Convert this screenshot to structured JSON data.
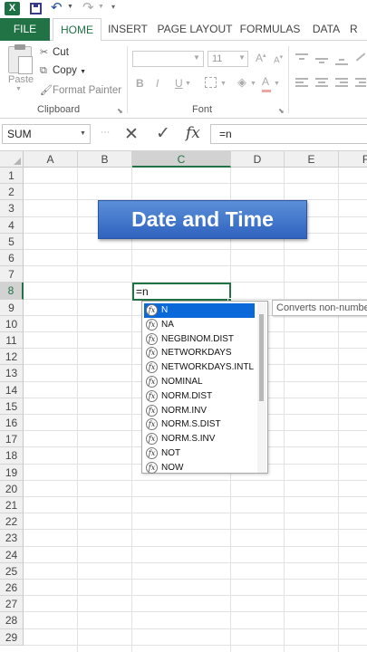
{
  "app": {
    "logo_letter": "X"
  },
  "tabs": [
    "FILE",
    "HOME",
    "INSERT",
    "PAGE LAYOUT",
    "FORMULAS",
    "DATA",
    "R"
  ],
  "ribbon": {
    "clipboard": {
      "paste": "Paste",
      "cut": "Cut",
      "copy": "Copy",
      "format_painter": "Format Painter",
      "group": "Clipboard"
    },
    "font": {
      "size": "11",
      "group": "Font"
    }
  },
  "formula_bar": {
    "name_box": "SUM",
    "content": "=n"
  },
  "grid": {
    "columns": [
      "A",
      "B",
      "C",
      "D",
      "E",
      "F"
    ],
    "rows": [
      "1",
      "2",
      "3",
      "4",
      "5",
      "6",
      "7",
      "8",
      "9",
      "10",
      "11",
      "12",
      "13",
      "14",
      "15",
      "16",
      "17",
      "18",
      "19",
      "20",
      "21",
      "22",
      "23",
      "24",
      "25",
      "26",
      "27",
      "28",
      "29"
    ],
    "selected_column": "C",
    "selected_row": "8",
    "banner_text": "Date and Time",
    "active_cell_text": "=n"
  },
  "autocomplete": {
    "items": [
      "N",
      "NA",
      "NEGBINOM.DIST",
      "NETWORKDAYS",
      "NETWORKDAYS.INTL",
      "NOMINAL",
      "NORM.DIST",
      "NORM.INV",
      "NORM.S.DIST",
      "NORM.S.INV",
      "NOT",
      "NOW"
    ],
    "selected_index": 0,
    "tooltip": "Converts non-numbe"
  },
  "colors": {
    "accent": "#217346",
    "selection": "#0a68d8",
    "banner": "#3a6fc9"
  },
  "icons": {
    "save": "save-icon",
    "undo": "undo-icon",
    "redo": "redo-icon",
    "cut": "scissors-icon",
    "copy": "copy-icon",
    "format_painter": "brush-icon",
    "function": "function-icon"
  }
}
